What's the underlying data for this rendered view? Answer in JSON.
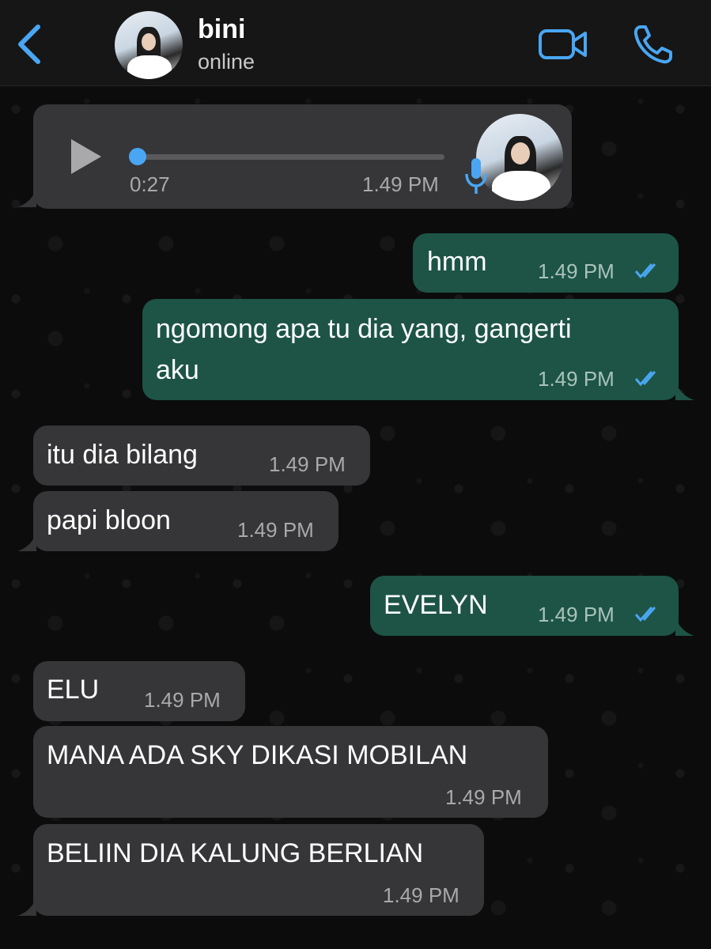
{
  "header": {
    "contact_name": "bini",
    "contact_status": "online",
    "icons": {
      "back": "chevron-left-icon",
      "video": "video-camera-icon",
      "call": "phone-icon",
      "avatar": "contact-avatar"
    },
    "accent_color": "#4aa6f2"
  },
  "voice_message": {
    "duration": "0:27",
    "time": "1.49 PM",
    "progress": 0.0,
    "icons": {
      "play": "play-icon",
      "mic": "microphone-icon"
    }
  },
  "messages": [
    {
      "direction": "outgoing",
      "text": "hmm",
      "time": "1.49 PM",
      "status": "read"
    },
    {
      "direction": "outgoing",
      "lines": [
        "ngomong apa tu dia yang, gangerti",
        "aku"
      ],
      "time": "1.49 PM",
      "status": "read"
    },
    {
      "direction": "incoming",
      "text": "itu dia bilang",
      "time": "1.49 PM"
    },
    {
      "direction": "incoming",
      "text": "papi bloon",
      "time": "1.49 PM"
    },
    {
      "direction": "outgoing",
      "text": "EVELYN",
      "time": "1.49 PM",
      "status": "read"
    },
    {
      "direction": "incoming",
      "text": "ELU",
      "time": "1.49 PM"
    },
    {
      "direction": "incoming",
      "text": "MANA ADA SKY DIKASI MOBILAN",
      "time": "1.49 PM"
    },
    {
      "direction": "incoming",
      "text": "BELIIN DIA KALUNG BERLIAN",
      "time": "1.49 PM"
    }
  ],
  "colors": {
    "incoming_bubble": "#363638",
    "outgoing_bubble": "#1d5446",
    "read_ticks": "#4aa6f2"
  }
}
